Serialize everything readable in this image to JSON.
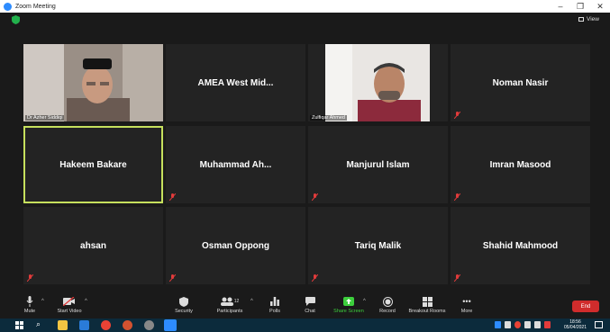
{
  "window": {
    "title": "Zoom Meeting"
  },
  "view_label": "View",
  "tiles": [
    {
      "name": "",
      "label": "Dr Azher Siddiqi"
    },
    {
      "name": "AMEA West Mid...",
      "label": ""
    },
    {
      "name": "",
      "label": "Zulfiqar Ahmed"
    },
    {
      "name": "Noman Nasir",
      "label": ""
    },
    {
      "name": "Hakeem Bakare",
      "label": ""
    },
    {
      "name": "Muhammad Ah...",
      "label": ""
    },
    {
      "name": "Manjurul Islam",
      "label": ""
    },
    {
      "name": "Imran Masood",
      "label": ""
    },
    {
      "name": "ahsan",
      "label": ""
    },
    {
      "name": "Osman Oppong",
      "label": ""
    },
    {
      "name": "Tariq Malik",
      "label": ""
    },
    {
      "name": "Shahid Mahmood",
      "label": ""
    }
  ],
  "toolbar": {
    "mute": "Mute",
    "start_video": "Start Video",
    "security": "Security",
    "participants": "Participants",
    "participants_count": "12",
    "polls": "Polls",
    "chat": "Chat",
    "share_screen": "Share Screen",
    "record": "Record",
    "breakout_rooms": "Breakout Rooms",
    "more": "More",
    "end": "End"
  },
  "taskbar": {
    "time": "18:56",
    "date": "05/04/2021"
  },
  "colors": {
    "active_speaker": "#c6e05d",
    "share_green": "#3ccf3c",
    "end_red": "#d02c2c"
  }
}
